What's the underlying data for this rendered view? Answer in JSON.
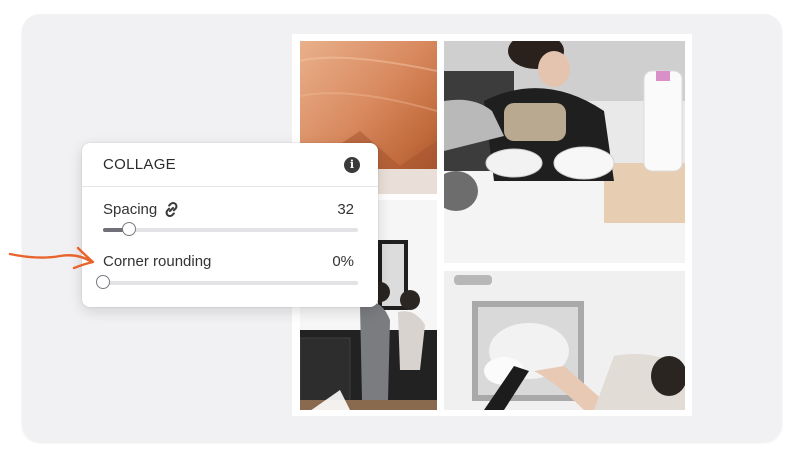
{
  "panel": {
    "title": "COLLAGE",
    "info_icon": "info-icon",
    "spacing": {
      "label": "Spacing",
      "value_text": "32",
      "icon": "link-icon",
      "slider_fraction": 0.1
    },
    "corner_rounding": {
      "label": "Corner rounding",
      "value_text": "0%",
      "slider_fraction": 0.0
    }
  },
  "collage": {
    "photos": [
      "copper-texture-photo",
      "kitchen-cereal-photo",
      "kitchen-couple-photo",
      "sink-washing-photo"
    ]
  },
  "annotation": {
    "icon": "hand-drawn-arrow",
    "color": "#e8642c"
  },
  "colors": {
    "background": "#f1f1f3",
    "panel": "#ffffff",
    "slider_fill": "#6f7078"
  }
}
